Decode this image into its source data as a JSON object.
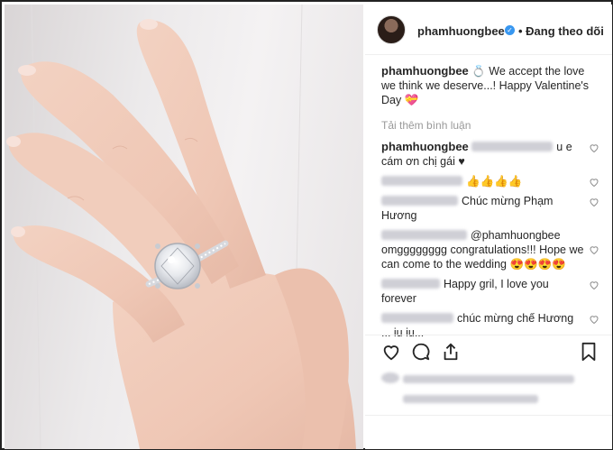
{
  "header": {
    "username": "phamhuongbee",
    "follow_status": "• Đang theo dõi"
  },
  "caption": {
    "username": "phamhuongbee",
    "text": " 💍 We accept the love we think we deserve...! Happy Valentine's Day 💝"
  },
  "load_more": "Tải thêm bình luận",
  "comments": [
    {
      "username": "phamhuongbee",
      "text": "u e cám ơn chị gái ♥"
    },
    {
      "username": "",
      "text": "👍👍👍👍"
    },
    {
      "username": "",
      "text": "Chúc mừng Phạm Hương"
    },
    {
      "username": "",
      "text": "@phamhuongbee omgggggggg congratulations!!! Hope we can come to the wedding 😍😍😍😍"
    },
    {
      "username": "",
      "text": "Happy gril, I love you forever"
    },
    {
      "username": "",
      "text": "chúc mừng chế Hương ... iu iu..."
    }
  ],
  "colors": {
    "verified": "#3897f0",
    "muted": "#999999",
    "text": "#262626"
  },
  "icons": [
    "heart-icon",
    "comment-icon",
    "share-icon",
    "bookmark-icon",
    "verified-badge-icon"
  ]
}
